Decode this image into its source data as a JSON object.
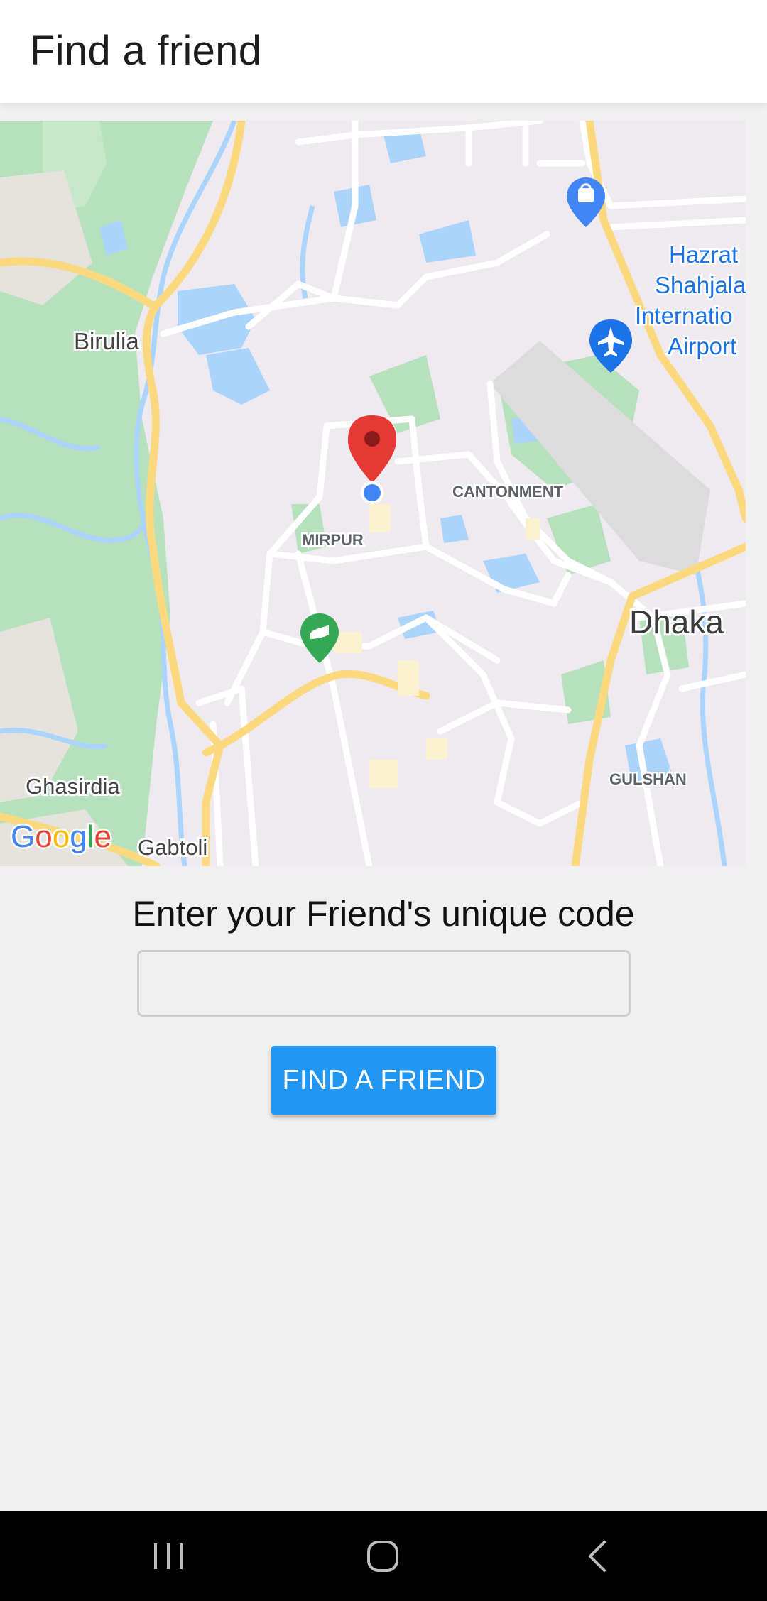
{
  "app_bar": {
    "title": "Find a friend"
  },
  "map": {
    "attribution_logo": "Google",
    "labels": {
      "birulia": "Birulia",
      "ghasirdia": "Ghasirdia",
      "gabtoli": "Gabtoli",
      "mirpur": "MIRPUR",
      "cantonment": "CANTONMENT",
      "dhaka": "Dhaka",
      "gulshan": "GULSHAN",
      "airport_line1": "Hazrat",
      "airport_line2": "Shahjala",
      "airport_line3": "Internatio",
      "airport_line4": "Airport"
    },
    "markers": {
      "location_pin": "red-location-pin",
      "current_location": "blue-dot",
      "shopping_poi": "shopping-bag-icon",
      "airport_poi": "airplane-icon",
      "park_poi": "park-icon"
    },
    "colors": {
      "land": "#eeeaf0",
      "water": "#aad4fb",
      "park": "#b5e3bd",
      "road_major": "#fde293",
      "road_minor": "#ffffff",
      "pin": "#e53935",
      "current_location": "#4285f4"
    }
  },
  "form": {
    "prompt": "Enter your Friend's unique code",
    "code_input_value": "",
    "code_input_placeholder": "",
    "button_label": "FIND A FRIEND",
    "button_color": "#2196f3"
  },
  "system_nav": {
    "icons": [
      "recent-apps-icon",
      "home-icon",
      "back-icon"
    ]
  }
}
